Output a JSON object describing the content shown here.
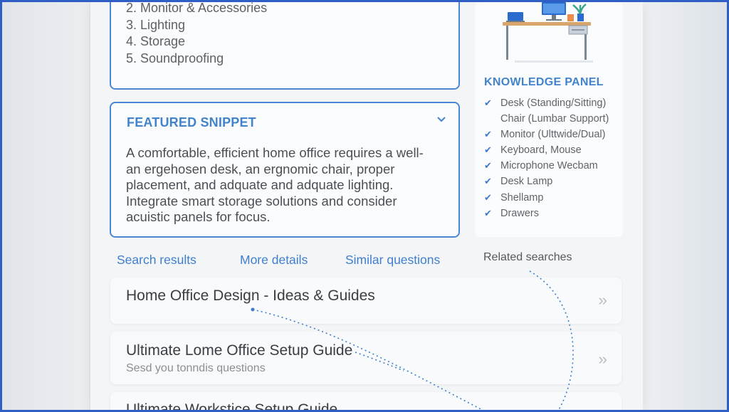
{
  "partial_list": {
    "items": [
      "2. Monitor & Accessories",
      "3. Lighting",
      "4. Storage",
      "5. Soundproofing"
    ]
  },
  "snippet": {
    "title": "FEATURED SNIPPET",
    "lines": [
      "A comfortable, efficient home office requires a well-",
      "an ergehosen desk, an ergnomic chair, proper",
      "placement, and adquate and adquate lighting.",
      "Integrate smart storage solutions and consider",
      "acuistic panels for focus."
    ]
  },
  "tabs": [
    "Search results",
    "More details",
    "Similar questions"
  ],
  "related_searches_label": "Related searches",
  "results": [
    {
      "title": "Home Office Design - Ideas & Guides",
      "subtitle": ""
    },
    {
      "title": "Ultimate Lome Office Setup Guide",
      "subtitle": "Sesd you tonndis questions"
    },
    {
      "title": "Ultimate Workstice Setup Guide",
      "subtitle": ""
    }
  ],
  "knowledge_panel": {
    "title": "KNOWLEDGE PANEL",
    "items": [
      {
        "label": "Desk (Standing/Sitting)",
        "checked": true
      },
      {
        "label": "Chair (Lumbar Support)",
        "checked": false
      },
      {
        "label": "Monitor (Ulttwide/Dual)",
        "checked": true
      },
      {
        "label": "Keyboard, Mouse",
        "checked": true
      },
      {
        "label": "Microphone Wecbam",
        "checked": true
      },
      {
        "label": "Desk Lamp",
        "checked": true
      },
      {
        "label": "Shellamp",
        "checked": true
      },
      {
        "label": "Drawers",
        "checked": true
      }
    ]
  },
  "colors": {
    "accent": "#4283cc",
    "border": "#4a86d4",
    "frame": "#2f5ec4",
    "text": "#4b4f55"
  },
  "icons": [
    "chevron-down-icon",
    "check-icon",
    "double-chevron-right-icon",
    "desk-illustration"
  ]
}
